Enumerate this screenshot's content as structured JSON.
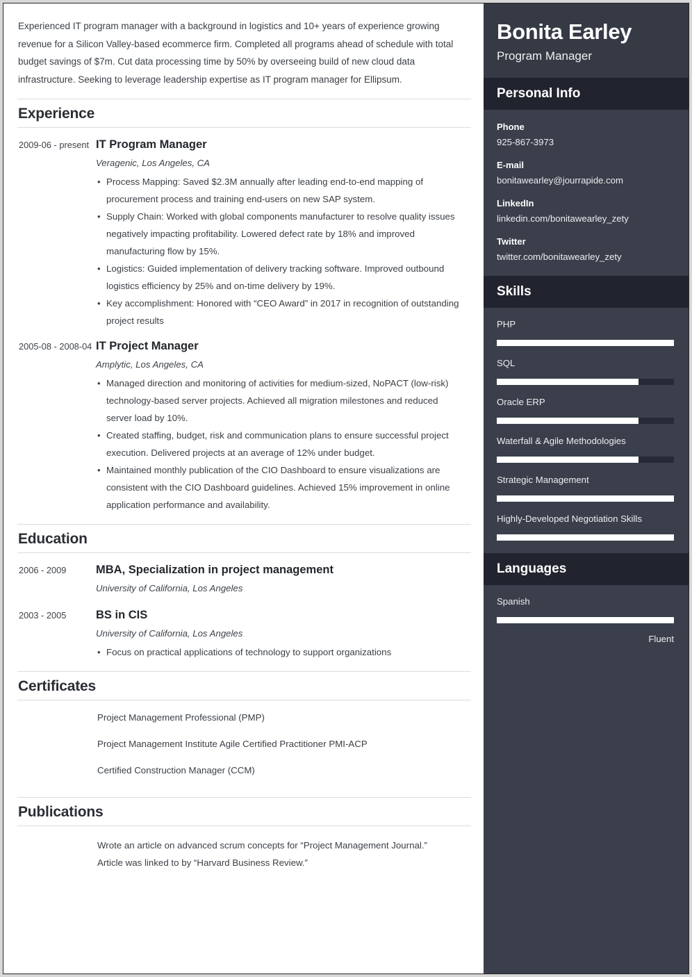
{
  "summary": "Experienced IT program manager with a background in logistics and 10+ years of experience growing revenue for a Silicon Valley-based ecommerce firm. Completed all programs ahead of schedule with total budget savings of $7m. Cut data processing time by 50% by overseeing build of new cloud data infrastructure. Seeking to leverage leadership expertise as IT program manager for Ellipsum.",
  "sections": {
    "experience_title": "Experience",
    "education_title": "Education",
    "certificates_title": "Certificates",
    "publications_title": "Publications"
  },
  "experience": [
    {
      "date": "2009-06 - present",
      "title": "IT Program Manager",
      "org": "Veragenic, Los Angeles, CA",
      "bullets": [
        "Process Mapping: Saved $2.3M annually after leading end-to-end mapping of procurement process and training end-users on new SAP system.",
        "Supply Chain: Worked with global components manufacturer to resolve quality issues negatively impacting profitability. Lowered defect rate by 18% and improved manufacturing flow by 15%.",
        "Logistics: Guided implementation of delivery tracking software. Improved outbound logistics efficiency by 25% and on-time delivery by 19%.",
        "Key accomplishment: Honored with “CEO Award” in 2017 in recognition of outstanding project results"
      ]
    },
    {
      "date": "2005-08 - 2008-04",
      "title": "IT Project Manager",
      "org": "Amplytic, Los Angeles, CA",
      "bullets": [
        "Managed direction and monitoring of activities for medium-sized, NoPACT (low-risk) technology-based server projects. Achieved all migration milestones and reduced server load by 10%.",
        "Created staffing, budget, risk and communication plans to ensure successful project execution. Delivered projects at an average of 12% under budget.",
        "Maintained monthly publication of the CIO Dashboard to ensure visualizations are consistent with the CIO Dashboard guidelines. Achieved 15% improvement in online application performance and availability."
      ]
    }
  ],
  "education": [
    {
      "date": "2006 - 2009",
      "title": "MBA, Specialization in project management",
      "org": "University of California, Los Angeles",
      "bullets": []
    },
    {
      "date": "2003 - 2005",
      "title": "BS in CIS",
      "org": "University of California, Los Angeles",
      "bullets": [
        "Focus on practical applications of technology to support organizations"
      ]
    }
  ],
  "certificates": [
    "Project Management Professional (PMP)",
    "Project Management Institute Agile Certified Practitioner PMI-ACP",
    "Certified Construction Manager (CCM)"
  ],
  "publications": [
    "Wrote an article on advanced scrum concepts for “Project Management Journal.”",
    "Article was linked to by “Harvard Business Review.”"
  ],
  "sidebar": {
    "name": "Bonita Earley",
    "role": "Program Manager",
    "personal_info_title": "Personal Info",
    "personal_info": [
      {
        "label": "Phone",
        "value": "925-867-3973"
      },
      {
        "label": "E-mail",
        "value": "bonitawearley@jourrapide.com"
      },
      {
        "label": "LinkedIn",
        "value": "linkedin.com/bonitawearley_zety"
      },
      {
        "label": "Twitter",
        "value": "twitter.com/bonitawearley_zety"
      }
    ],
    "skills_title": "Skills",
    "skills": [
      {
        "name": "PHP",
        "level": 100
      },
      {
        "name": "SQL",
        "level": 80
      },
      {
        "name": "Oracle ERP",
        "level": 80
      },
      {
        "name": "Waterfall & Agile Methodologies",
        "level": 80
      },
      {
        "name": "Strategic Management",
        "level": 100
      },
      {
        "name": "Highly-Developed Negotiation Skills",
        "level": 100
      }
    ],
    "languages_title": "Languages",
    "languages": [
      {
        "name": "Spanish",
        "level": 100,
        "label": "Fluent"
      }
    ]
  },
  "colors": {
    "sidebar_bg": "#3a3f4b",
    "sidebar_top_bg": "#353a45",
    "sidebar_head_bg": "#21242e",
    "bar_fill": "#ffffff",
    "bar_track": "#262a36",
    "text_dark": "#33373d",
    "rule": "#dcdcdc"
  }
}
